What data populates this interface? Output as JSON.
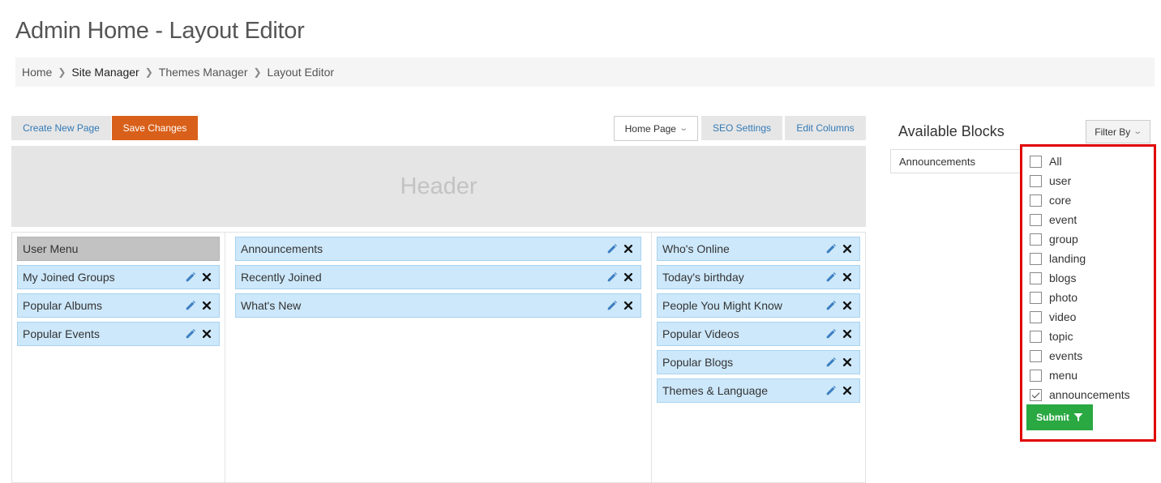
{
  "page": {
    "title": "Admin Home - Layout Editor"
  },
  "breadcrumb": [
    {
      "label": "Home"
    },
    {
      "label": "Site Manager"
    },
    {
      "label": "Themes Manager"
    },
    {
      "label": "Layout Editor"
    }
  ],
  "toolbar": {
    "create_new_page": "Create New Page",
    "save_changes": "Save Changes",
    "page_select": "Home Page",
    "seo_settings": "SEO Settings",
    "edit_columns": "Edit Columns"
  },
  "header_region": {
    "label": "Header"
  },
  "columns": {
    "left": {
      "fixed_block": "User Menu",
      "blocks": [
        "My Joined Groups",
        "Popular Albums",
        "Popular Events"
      ]
    },
    "middle": {
      "blocks": [
        "Announcements",
        "Recently Joined",
        "What's New"
      ]
    },
    "right": {
      "blocks": [
        "Who's Online",
        "Today's birthday",
        "People You Might Know",
        "Popular Videos",
        "Popular Blogs",
        "Themes & Language"
      ]
    }
  },
  "available_blocks": {
    "title": "Available Blocks",
    "filter_button": "Filter By",
    "items": [
      "Announcements"
    ]
  },
  "filter": {
    "options": [
      {
        "label": "All",
        "checked": false
      },
      {
        "label": "user",
        "checked": false
      },
      {
        "label": "core",
        "checked": false
      },
      {
        "label": "event",
        "checked": false
      },
      {
        "label": "group",
        "checked": false
      },
      {
        "label": "landing",
        "checked": false
      },
      {
        "label": "blogs",
        "checked": false
      },
      {
        "label": "photo",
        "checked": false
      },
      {
        "label": "video",
        "checked": false
      },
      {
        "label": "topic",
        "checked": false
      },
      {
        "label": "events",
        "checked": false
      },
      {
        "label": "menu",
        "checked": false
      },
      {
        "label": "announcements",
        "checked": true
      }
    ],
    "submit": "Submit"
  },
  "colors": {
    "accent_orange": "#d9601a",
    "block_blue": "#cde8fb",
    "submit_green": "#2aa842",
    "highlight_red": "#e00000",
    "link_blue": "#337ab7"
  }
}
